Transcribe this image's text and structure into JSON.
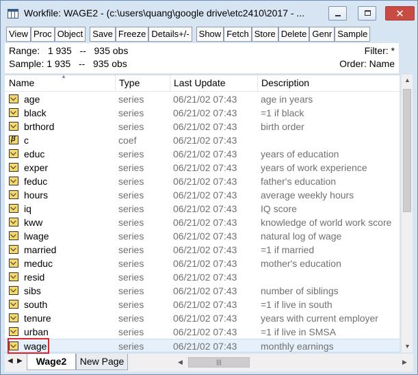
{
  "window": {
    "title": "Workfile: WAGE2 - (c:\\users\\quang\\google drive\\etc2410\\2017 - ...",
    "minimize": "minimize",
    "maximize": "maximize",
    "close": "close"
  },
  "toolbar": [
    "View",
    "Proc",
    "Object",
    "Save",
    "Freeze",
    "Details+/-",
    "Show",
    "Fetch",
    "Store",
    "Delete",
    "Genr",
    "Sample"
  ],
  "info": {
    "range": "Range:   1 935   --   935 obs",
    "sample": "Sample: 1 935   --   935 obs",
    "filter": "Filter: *",
    "order": "Order: Name"
  },
  "columns": {
    "name": "Name",
    "type": "Type",
    "last_update": "Last Update",
    "description": "Description"
  },
  "rows": [
    {
      "name": "age",
      "type": "series",
      "date": "06/21/02  07:43",
      "desc": "age in years"
    },
    {
      "name": "black",
      "type": "series",
      "date": "06/21/02  07:43",
      "desc": "=1 if black"
    },
    {
      "name": "brthord",
      "type": "series",
      "date": "06/21/02  07:43",
      "desc": "birth order"
    },
    {
      "name": "c",
      "type": "coef",
      "date": "06/21/02  07:43",
      "desc": ""
    },
    {
      "name": "educ",
      "type": "series",
      "date": "06/21/02  07:43",
      "desc": "years of education"
    },
    {
      "name": "exper",
      "type": "series",
      "date": "06/21/02  07:43",
      "desc": "years of work experience"
    },
    {
      "name": "feduc",
      "type": "series",
      "date": "06/21/02  07:43",
      "desc": "father's education"
    },
    {
      "name": "hours",
      "type": "series",
      "date": "06/21/02  07:43",
      "desc": "average weekly hours"
    },
    {
      "name": "iq",
      "type": "series",
      "date": "06/21/02  07:43",
      "desc": "IQ score"
    },
    {
      "name": "kww",
      "type": "series",
      "date": "06/21/02  07:43",
      "desc": "knowledge of world work score"
    },
    {
      "name": "lwage",
      "type": "series",
      "date": "06/21/02  07:43",
      "desc": "natural log of wage"
    },
    {
      "name": "married",
      "type": "series",
      "date": "06/21/02  07:43",
      "desc": "=1 if married"
    },
    {
      "name": "meduc",
      "type": "series",
      "date": "06/21/02  07:43",
      "desc": "mother's education"
    },
    {
      "name": "resid",
      "type": "series",
      "date": "06/21/02  07:43",
      "desc": ""
    },
    {
      "name": "sibs",
      "type": "series",
      "date": "06/21/02  07:43",
      "desc": "number of siblings"
    },
    {
      "name": "south",
      "type": "series",
      "date": "06/21/02  07:43",
      "desc": "=1 if live in south"
    },
    {
      "name": "tenure",
      "type": "series",
      "date": "06/21/02  07:43",
      "desc": "years with current employer"
    },
    {
      "name": "urban",
      "type": "series",
      "date": "06/21/02  07:43",
      "desc": "=1 if live in SMSA"
    },
    {
      "name": "wage",
      "type": "series",
      "date": "06/21/02  07:43",
      "desc": "monthly earnings"
    }
  ],
  "tabs": {
    "active": "Wage2",
    "new": "New Page"
  },
  "selected_row": "wage",
  "colors": {
    "selection": "#e6f0fb",
    "highlight_border": "#e0242b",
    "series_icon": "#f5d76a"
  }
}
